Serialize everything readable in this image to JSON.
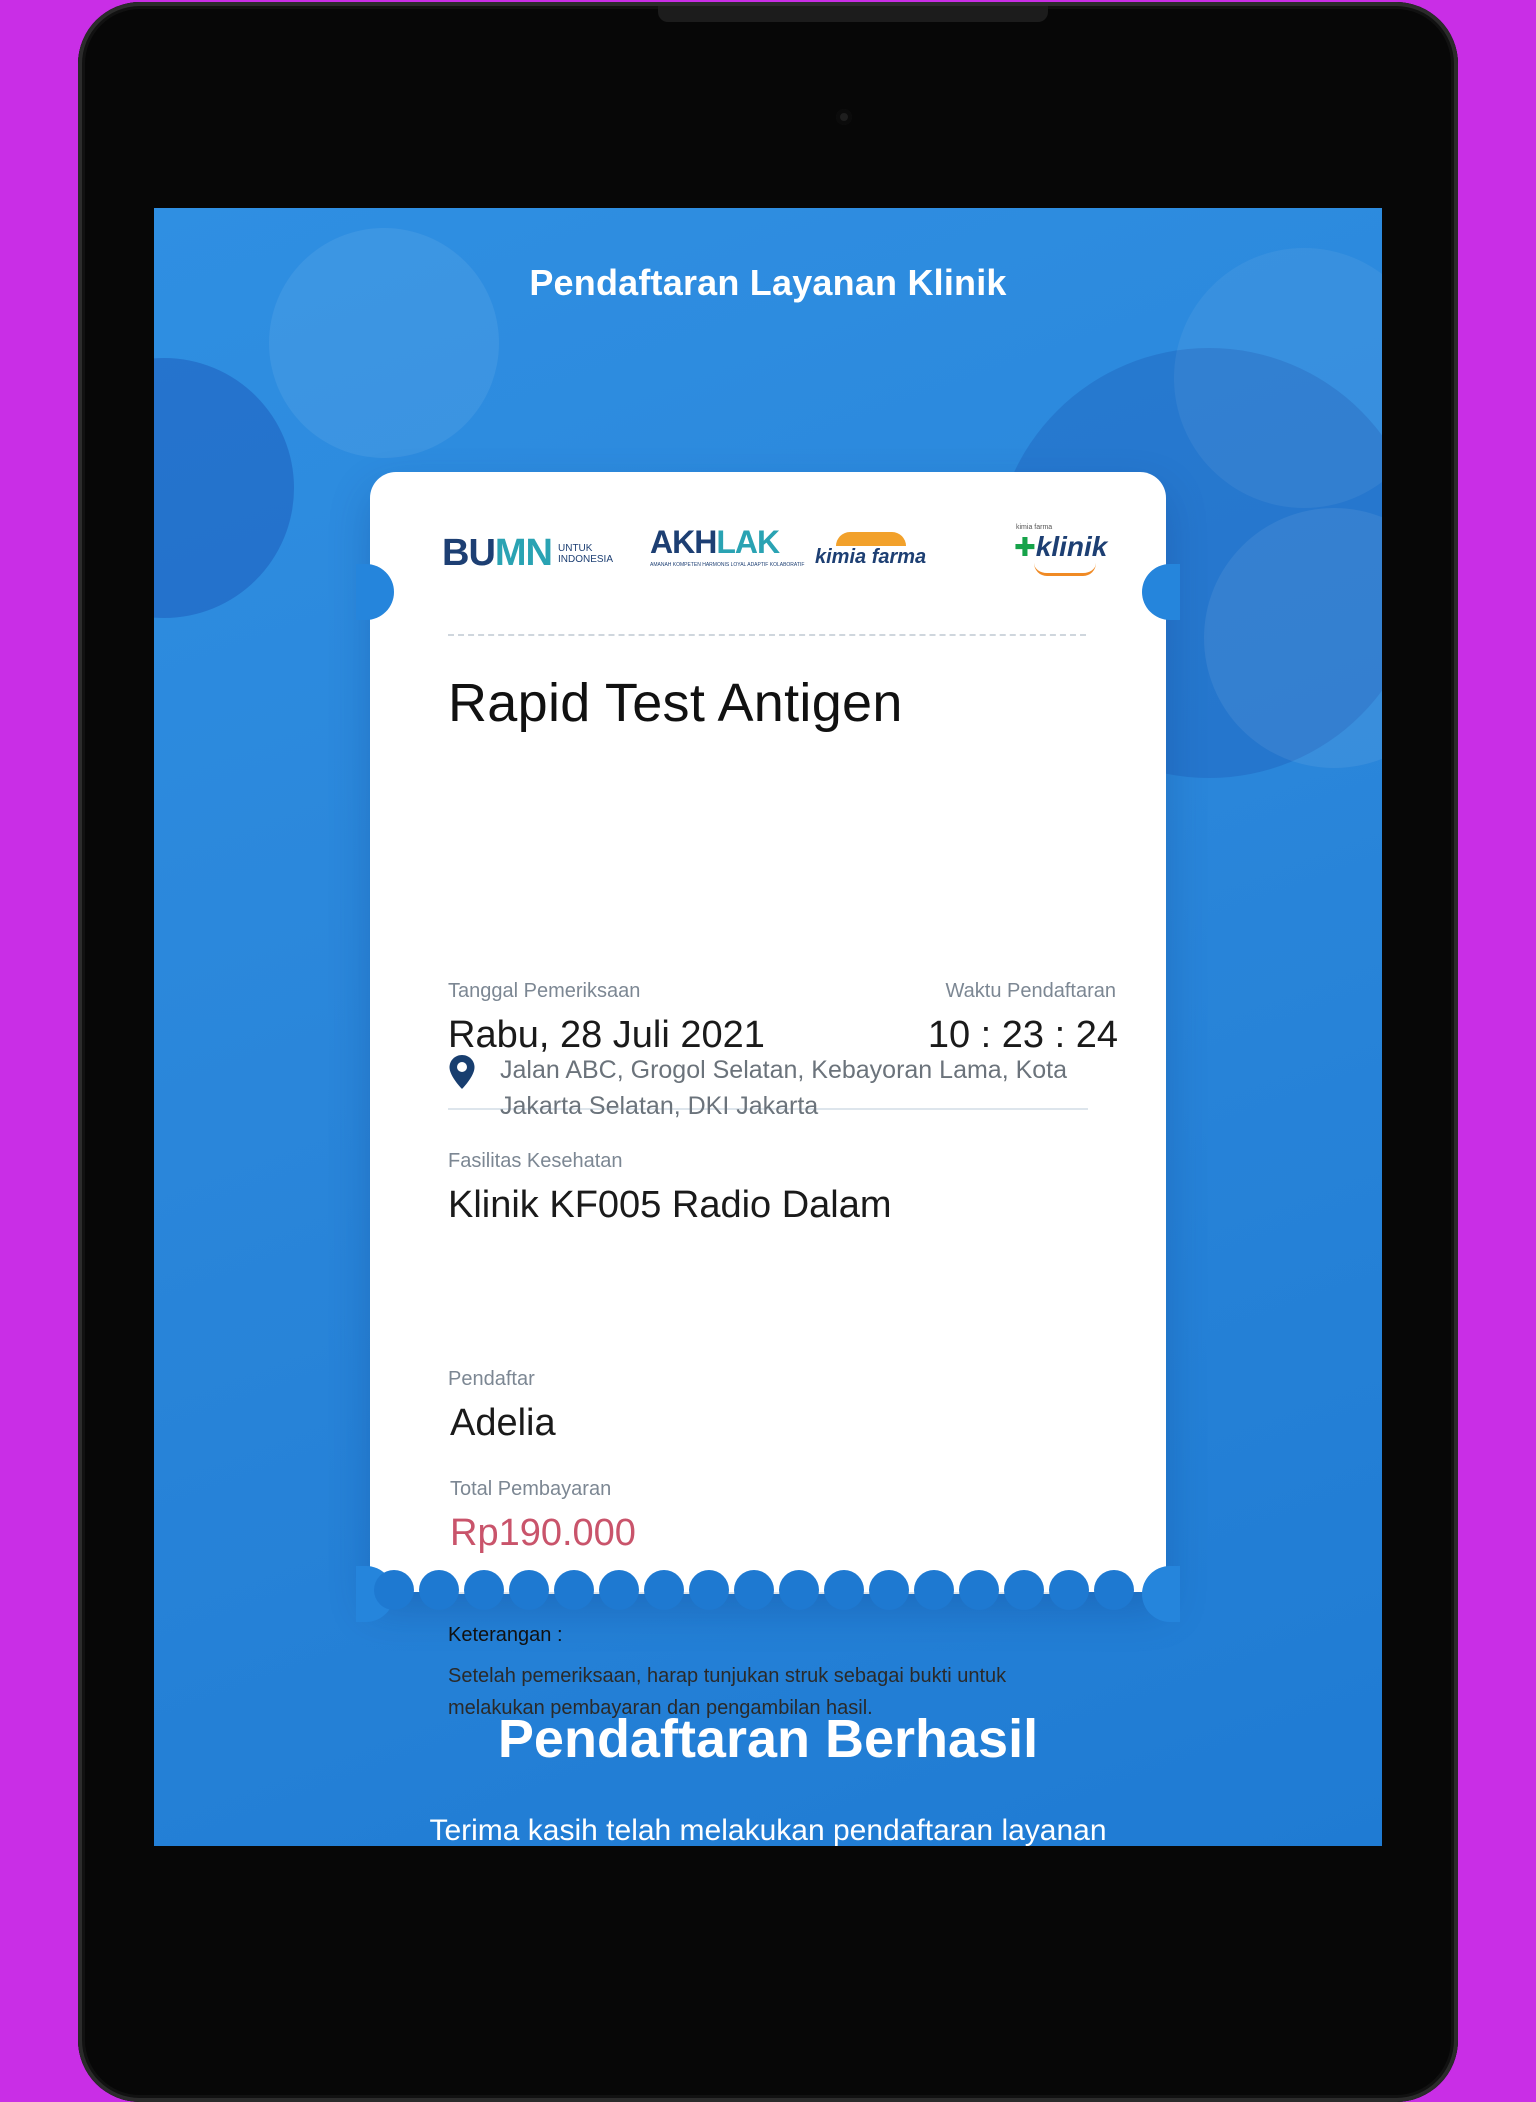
{
  "header": {
    "title": "Pendaftaran Layanan Klinik"
  },
  "logos": {
    "bumn": {
      "mark_a": "BU",
      "mark_b": "MN",
      "sub_1": "UNTUK",
      "sub_2": "INDONESIA"
    },
    "akhlak": {
      "mark_a": "AKH",
      "mark_b": "LAK",
      "sub": "AMANAH KOMPETEN HARMONIS LOYAL ADAPTIF KOLABORATIF"
    },
    "kimia_farma": {
      "text": "kimia farma"
    },
    "klinik": {
      "small": "kimia farma",
      "text": "klinik",
      "cross": "✚"
    }
  },
  "ticket": {
    "service": "Rapid Test Antigen",
    "date_label": "Tanggal Pemeriksaan",
    "date_value": "Rabu, 28 Juli 2021",
    "time_label": "Waktu Pendaftaran",
    "time_value": "10 : 23 : 24",
    "facility_label": "Fasilitas Kesehatan",
    "facility_value": "Klinik KF005 Radio Dalam",
    "address": "Jalan ABC, Grogol Selatan, Kebayoran Lama, Kota Jakarta Selatan, DKI Jakarta",
    "registrant_label": "Pendaftar",
    "registrant_value": "Adelia",
    "payment_label": "Total Pembayaran",
    "payment_value": "Rp190.000",
    "note_title": "Keterangan :",
    "note_body": "Setelah pemeriksaan, harap tunjukan struk sebagai bukti untuk melakukan pembayaran dan pengambilan hasil."
  },
  "success": {
    "title": "Pendaftaran Berhasil",
    "message": "Terima kasih telah melakukan pendaftaran layanan"
  },
  "icons": {
    "location": "location-pin-icon"
  },
  "colors": {
    "brand_blue": "#2a86da",
    "price": "#c9546b",
    "frame_bg": "#c92ee6",
    "device": "#070707"
  }
}
